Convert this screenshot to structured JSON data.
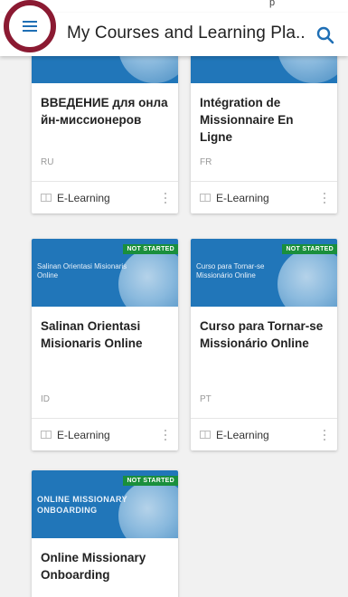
{
  "status_fragment": "p",
  "app_bar": {
    "title": "My Courses and Learning Pla.."
  },
  "courses": [
    {
      "title": "ВВЕДЕНИЕ для онла йн-миссионеров",
      "language": "RU",
      "type": "E-Learning",
      "badge": "",
      "banner_text": ""
    },
    {
      "title": "Intégration de Missionnaire En Ligne",
      "language": "FR",
      "type": "E-Learning",
      "badge": "",
      "banner_text": ""
    },
    {
      "title": "Salinan Orientasi Misionaris Online",
      "language": "ID",
      "type": "E-Learning",
      "badge": "NOT STARTED",
      "banner_text": "Salinan Orientasi Misionaris Online"
    },
    {
      "title": "Curso para Tornar-se Missionário Online",
      "language": "PT",
      "type": "E-Learning",
      "badge": "NOT STARTED",
      "banner_text": "Curso para Tornar-se Missionário Online"
    },
    {
      "title": "Online Missionary Onboarding",
      "language": "",
      "type": "",
      "badge": "NOT STARTED",
      "banner_text": "ONLINE MISSIONARY ONBOARDING"
    }
  ],
  "colors": {
    "accent": "#1f6fb5",
    "banner": "#2176b9",
    "badge": "#1a8f3c",
    "highlight_ring": "#8b1a32"
  },
  "icons": {
    "menu": "hamburger-icon",
    "search": "search-icon",
    "elearning": "elearning-icon",
    "more": "kebab-icon"
  }
}
